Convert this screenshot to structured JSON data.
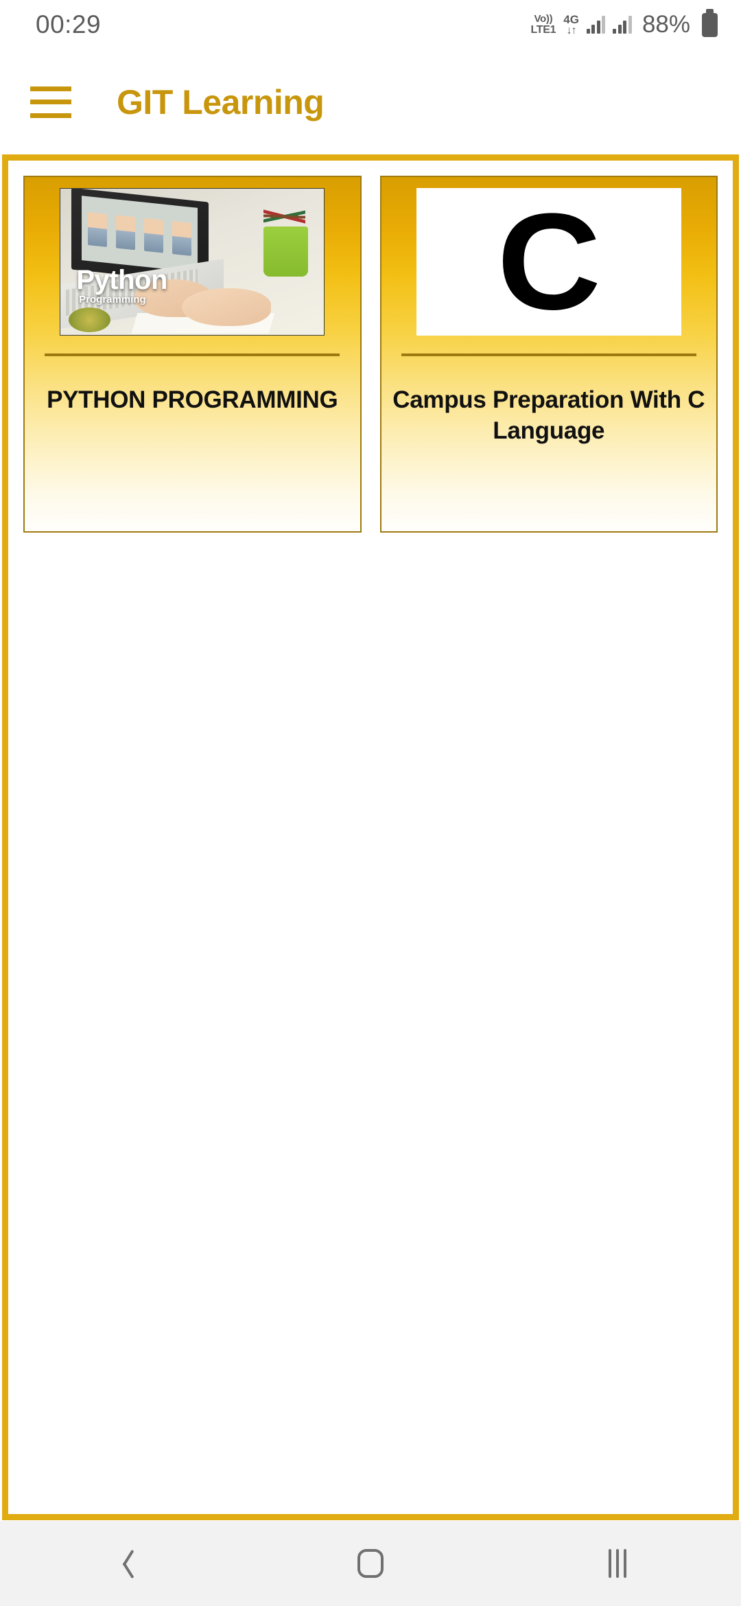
{
  "status_bar": {
    "time": "00:29",
    "volte_top": "Vo))",
    "volte_bottom": "LTE1",
    "network_gen": "4G",
    "network_arrows": "↓↑",
    "battery_percent": "88%"
  },
  "app_bar": {
    "menu_icon": "hamburger-menu-icon",
    "title": "GIT Learning"
  },
  "courses": [
    {
      "thumb_type": "image",
      "thumb_overlay_title": "Python",
      "thumb_overlay_subtitle": "Programming",
      "label": "PYTHON PROGRAMMING"
    },
    {
      "thumb_type": "letter",
      "thumb_letter": "C",
      "label": "Campus Preparation With C Language"
    }
  ],
  "nav_bar": {
    "back_label": "Back",
    "home_label": "Home",
    "recents_label": "Recents"
  },
  "colors": {
    "brand_gold": "#C8960C",
    "frame_gold": "#E0AC12",
    "card_top_gold": "#D99E00",
    "card_border": "#9E7A11",
    "status_gray": "#5b5b5b",
    "nav_bg": "#F2F2F2"
  }
}
